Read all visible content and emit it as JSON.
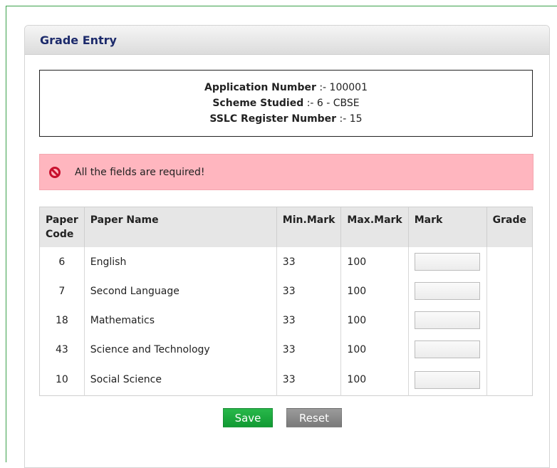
{
  "panel": {
    "title": "Grade Entry"
  },
  "info": {
    "application_number_label": "Application Number",
    "application_number_value": ":- 100001",
    "scheme_label": "Scheme Studied",
    "scheme_value": ":- 6 - CBSE",
    "sslc_label": "SSLC Register Number",
    "sslc_value": ":- 15"
  },
  "alert": {
    "icon": "error-icon",
    "message": "All the fields are required!",
    "color": "#ffb6bf"
  },
  "table": {
    "headers": {
      "paper_code": "Paper Code",
      "paper_name": "Paper Name",
      "min_mark": "Min.Mark",
      "max_mark": "Max.Mark",
      "mark": "Mark",
      "grade": "Grade"
    },
    "rows": [
      {
        "code": "6",
        "name": "English",
        "min": "33",
        "max": "100",
        "mark": "",
        "grade": ""
      },
      {
        "code": "7",
        "name": "Second Language",
        "min": "33",
        "max": "100",
        "mark": "",
        "grade": ""
      },
      {
        "code": "18",
        "name": "Mathematics",
        "min": "33",
        "max": "100",
        "mark": "",
        "grade": ""
      },
      {
        "code": "43",
        "name": "Science and Technology",
        "min": "33",
        "max": "100",
        "mark": "",
        "grade": ""
      },
      {
        "code": "10",
        "name": "Social Science",
        "min": "33",
        "max": "100",
        "mark": "",
        "grade": ""
      }
    ]
  },
  "buttons": {
    "save_label": "Save",
    "reset_label": "Reset",
    "save_color": "#1aa83d",
    "reset_color": "#888888"
  }
}
